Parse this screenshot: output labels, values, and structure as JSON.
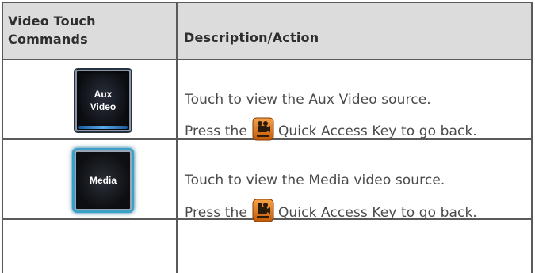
{
  "header": {
    "col1": "Video Touch\nCommands",
    "col1_line1": "Video Touch",
    "col1_line2": "Commands",
    "col2": "Description/Action"
  },
  "rows": [
    {
      "button_line1": "Aux",
      "button_line2": "Video",
      "line1": "Touch to view the Aux Video source.",
      "line2_before": "Press the",
      "line2_after": "Quick Access Key to go back.",
      "key_icon": "video-quick-access-key-icon"
    },
    {
      "button_line1": "Media",
      "line1": "Touch to view the Media video source.",
      "line2_before": "Press the",
      "line2_after": "Quick Access Key to go back.",
      "key_icon": "video-quick-access-key-icon"
    }
  ],
  "colors": {
    "header_bg": "#dcdcdc",
    "border": "#5a5a5a",
    "key_orange": "#e07a1a",
    "aux_accent": "#3a8ad0",
    "media_glow": "#3aa0c8"
  }
}
